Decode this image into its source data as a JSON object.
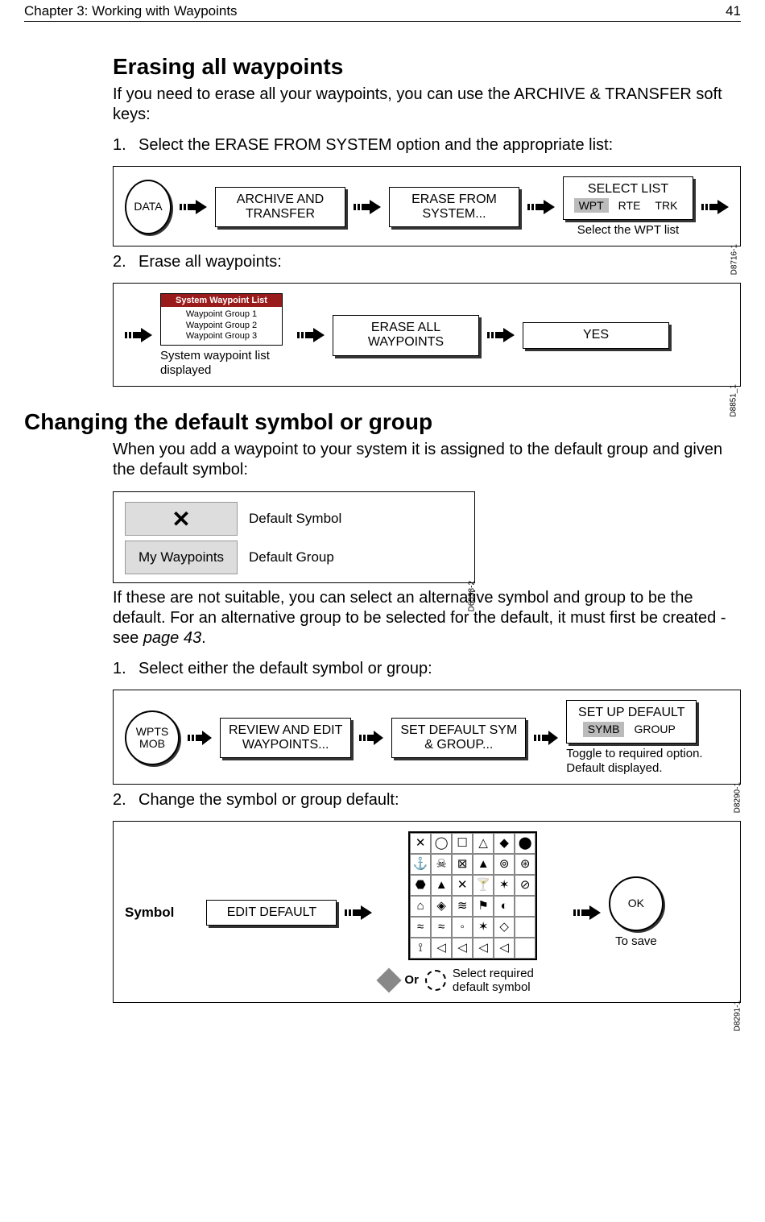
{
  "header": {
    "chapter": "Chapter 3: Working with Waypoints",
    "page": "41"
  },
  "sec1": {
    "title": "Erasing all waypoints",
    "intro": "If you need to erase all your waypoints, you can use the ARCHIVE & TRANSFER soft keys:",
    "step1": "Select the ERASE FROM SYSTEM option and the appropriate list:",
    "step2": "Erase all waypoints:"
  },
  "fig1": {
    "data_btn": "DATA",
    "k1": "ARCHIVE AND\nTRANSFER",
    "k2": "ERASE FROM\nSYSTEM...",
    "k3_top": "SELECT LIST",
    "k3_opts": {
      "a": "WPT",
      "b": "RTE",
      "c": "TRK"
    },
    "caption": "Select the WPT list",
    "ref": "D8716-1"
  },
  "fig2": {
    "list_title": "System Waypoint List",
    "list": [
      "Waypoint Group 1",
      "Waypoint Group 2",
      "Waypoint Group 3"
    ],
    "caption": "System waypoint list displayed",
    "k1": "ERASE ALL\nWAYPOINTS",
    "k2": "YES",
    "ref": "D8851_1"
  },
  "sec2": {
    "title": "Changing the default symbol or group",
    "intro": "When you add a waypoint to your system it is assigned to the default group and given the default symbol:",
    "para2a": "If these are not suitable, you can select an alternative symbol and group to be the default. For an alternative group to be selected for the default, it must first be created - see ",
    "para2b_link": "page 43",
    "para2c": ".",
    "step1": "Select either the default symbol or group:",
    "step2": "Change the symbol or group default:"
  },
  "fig3": {
    "sym_label": "Default Symbol",
    "grp_value": "My Waypoints",
    "grp_label": "Default Group",
    "ref": "D6558-2"
  },
  "fig4": {
    "btn": "WPTS\nMOB",
    "k1": "REVIEW AND EDIT\nWAYPOINTS...",
    "k2": "SET DEFAULT SYM\n& GROUP...",
    "k3_top": "SET UP DEFAULT",
    "k3_opts": {
      "a": "SYMB",
      "b": "GROUP"
    },
    "caption": "Toggle to required option. Default displayed.",
    "ref": "D8290-1"
  },
  "fig5": {
    "symbol_label": "Symbol",
    "k1": "EDIT DEFAULT",
    "ok": "OK",
    "ok_caption": "To save",
    "or": "Or",
    "select_caption": "Select required default symbol",
    "ref": "D8291-1",
    "palette": [
      "✕",
      "◯",
      "☐",
      "△",
      "◆",
      "⬤",
      "⚓",
      "☠",
      "⊠",
      "▲",
      "⊚",
      "⊛",
      "⬣",
      "▲",
      "✕",
      "🍸",
      "✶",
      "⊘",
      "⌂",
      "◈",
      "≋",
      "⚑",
      "◐",
      "",
      "≈",
      "≈",
      "◦",
      "✶",
      "◇",
      "",
      "⟟",
      "◁",
      "◁",
      "◁",
      "◁",
      ""
    ]
  }
}
